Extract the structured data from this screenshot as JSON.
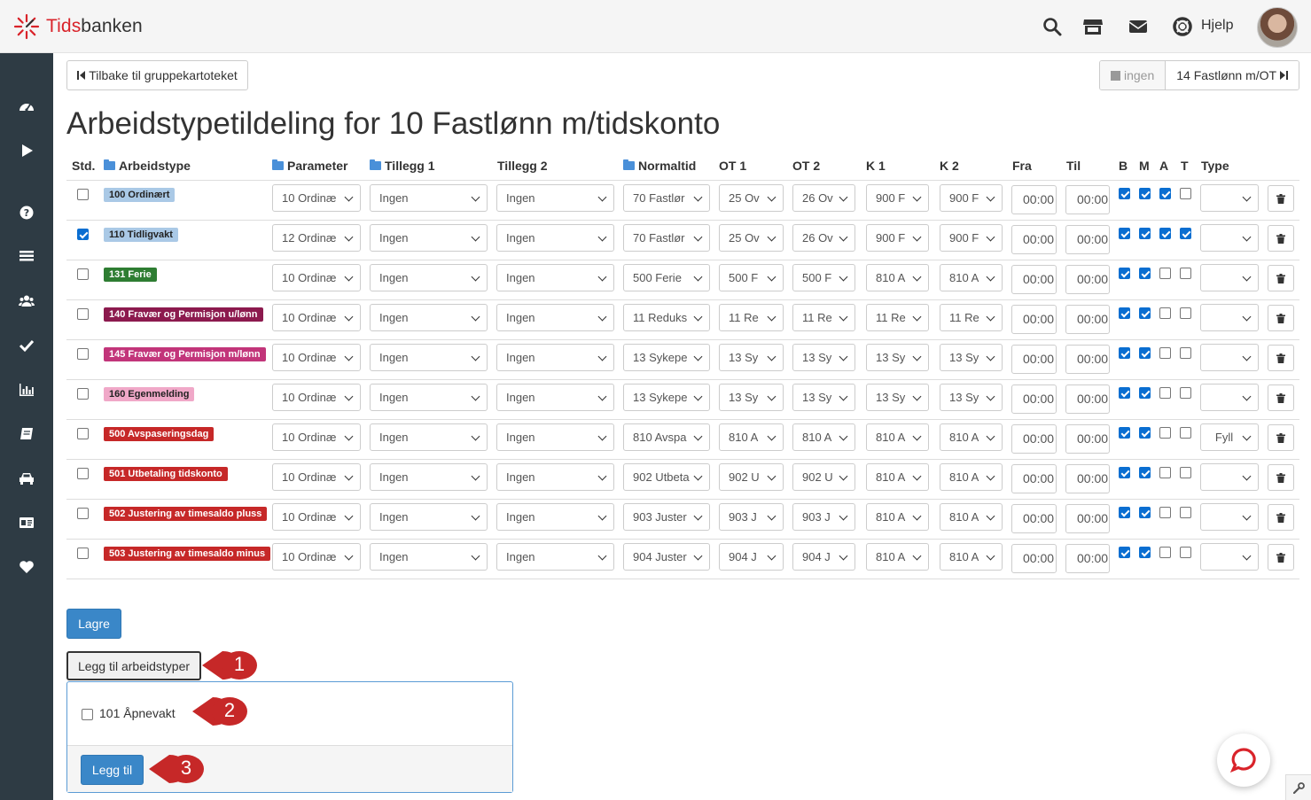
{
  "app": {
    "logo_prefix": "Tids",
    "logo_suffix": "banken",
    "help_label": "Hjelp"
  },
  "toolbar": {
    "back_label": "Tilbake til gruppekartoteket",
    "prev_label": "ingen",
    "next_label": "14 Fastlønn m/OT"
  },
  "page": {
    "title": "Arbeidstypetildeling for 10 Fastlønn m/tidskonto"
  },
  "table": {
    "headers": {
      "std": "Std.",
      "arbeidstype": "Arbeidstype",
      "parameter": "Parameter",
      "tillegg1": "Tillegg 1",
      "tillegg2": "Tillegg 2",
      "normaltid": "Normaltid",
      "ot1": "OT 1",
      "ot2": "OT 2",
      "k1": "K 1",
      "k2": "K 2",
      "fra": "Fra",
      "til": "Til",
      "b": "B",
      "m": "M",
      "a": "A",
      "t": "T",
      "type": "Type"
    },
    "rows": [
      {
        "std": false,
        "name": "100 Ordinært",
        "color": "#aac9e6",
        "dark": true,
        "parameter": "10 Ordinæ",
        "tillegg1": "Ingen",
        "tillegg2": "Ingen",
        "normaltid": "70 Fastlør",
        "ot1": "25 Ov",
        "ot2": "26 Ov",
        "k1": "900 F",
        "k2": "900 F",
        "fra": "00:00",
        "til": "00:00",
        "b": true,
        "m": true,
        "a": true,
        "t": false,
        "type": ""
      },
      {
        "std": true,
        "name": "110 Tidligvakt",
        "color": "#aac9e6",
        "dark": true,
        "parameter": "12 Ordinæ",
        "tillegg1": "Ingen",
        "tillegg2": "Ingen",
        "normaltid": "70 Fastlør",
        "ot1": "25 Ov",
        "ot2": "26 Ov",
        "k1": "900 F",
        "k2": "900 F",
        "fra": "00:00",
        "til": "00:00",
        "b": true,
        "m": true,
        "a": true,
        "t": true,
        "type": ""
      },
      {
        "std": false,
        "name": "131 Ferie",
        "color": "#2e7d32",
        "dark": false,
        "parameter": "10 Ordinæ",
        "tillegg1": "Ingen",
        "tillegg2": "Ingen",
        "normaltid": "500 Ferie",
        "ot1": "500 F",
        "ot2": "500 F",
        "k1": "810 A",
        "k2": "810 A",
        "fra": "00:00",
        "til": "00:00",
        "b": true,
        "m": true,
        "a": false,
        "t": false,
        "type": ""
      },
      {
        "std": false,
        "name": "140 Fravær og Permisjon u/lønn",
        "color": "#8c1a4e",
        "dark": false,
        "parameter": "10 Ordinæ",
        "tillegg1": "Ingen",
        "tillegg2": "Ingen",
        "normaltid": "11 Reduks",
        "ot1": "11 Re",
        "ot2": "11 Re",
        "k1": "11 Re",
        "k2": "11 Re",
        "fra": "00:00",
        "til": "00:00",
        "b": true,
        "m": true,
        "a": false,
        "t": false,
        "type": ""
      },
      {
        "std": false,
        "name": "145 Fravær og Permisjon m/lønn",
        "color": "#c2357a",
        "dark": false,
        "parameter": "10 Ordinæ",
        "tillegg1": "Ingen",
        "tillegg2": "Ingen",
        "normaltid": "13 Sykepe",
        "ot1": "13 Sy",
        "ot2": "13 Sy",
        "k1": "13 Sy",
        "k2": "13 Sy",
        "fra": "00:00",
        "til": "00:00",
        "b": true,
        "m": true,
        "a": false,
        "t": false,
        "type": ""
      },
      {
        "std": false,
        "name": "160 Egenmelding",
        "color": "#f0a8c8",
        "dark": true,
        "parameter": "10 Ordinæ",
        "tillegg1": "Ingen",
        "tillegg2": "Ingen",
        "normaltid": "13 Sykepe",
        "ot1": "13 Sy",
        "ot2": "13 Sy",
        "k1": "13 Sy",
        "k2": "13 Sy",
        "fra": "00:00",
        "til": "00:00",
        "b": true,
        "m": true,
        "a": false,
        "t": false,
        "type": ""
      },
      {
        "std": false,
        "name": "500 Avspaseringsdag",
        "color": "#c62828",
        "dark": false,
        "parameter": "10 Ordinæ",
        "tillegg1": "Ingen",
        "tillegg2": "Ingen",
        "normaltid": "810 Avspa",
        "ot1": "810 A",
        "ot2": "810 A",
        "k1": "810 A",
        "k2": "810 A",
        "fra": "00:00",
        "til": "00:00",
        "b": true,
        "m": true,
        "a": false,
        "t": false,
        "type": "Fyll"
      },
      {
        "std": false,
        "name": "501 Utbetaling tidskonto",
        "color": "#c62828",
        "dark": false,
        "parameter": "10 Ordinæ",
        "tillegg1": "Ingen",
        "tillegg2": "Ingen",
        "normaltid": "902 Utbeta",
        "ot1": "902 U",
        "ot2": "902 U",
        "k1": "810 A",
        "k2": "810 A",
        "fra": "00:00",
        "til": "00:00",
        "b": true,
        "m": true,
        "a": false,
        "t": false,
        "type": ""
      },
      {
        "std": false,
        "name": "502 Justering av timesaldo pluss",
        "color": "#c62828",
        "dark": false,
        "parameter": "10 Ordinæ",
        "tillegg1": "Ingen",
        "tillegg2": "Ingen",
        "normaltid": "903 Juster",
        "ot1": "903 J",
        "ot2": "903 J",
        "k1": "810 A",
        "k2": "810 A",
        "fra": "00:00",
        "til": "00:00",
        "b": true,
        "m": true,
        "a": false,
        "t": false,
        "type": ""
      },
      {
        "std": false,
        "name": "503 Justering av timesaldo minus",
        "color": "#c62828",
        "dark": false,
        "parameter": "10 Ordinæ",
        "tillegg1": "Ingen",
        "tillegg2": "Ingen",
        "normaltid": "904 Juster",
        "ot1": "904 J",
        "ot2": "904 J",
        "k1": "810 A",
        "k2": "810 A",
        "fra": "00:00",
        "til": "00:00",
        "b": true,
        "m": true,
        "a": false,
        "t": false,
        "type": ""
      }
    ]
  },
  "actions": {
    "save_label": "Lagre",
    "add_types_label": "Legg til arbeidstyper",
    "add_option_label": "101 Åpnevakt",
    "add_option_checked": false,
    "add_button_label": "Legg til"
  },
  "callouts": [
    "1",
    "2",
    "3"
  ],
  "colors": {
    "sidebar": "#2e3b44",
    "primary": "#3a87c8",
    "callout": "#c62828",
    "brand_red": "#d9232a"
  }
}
